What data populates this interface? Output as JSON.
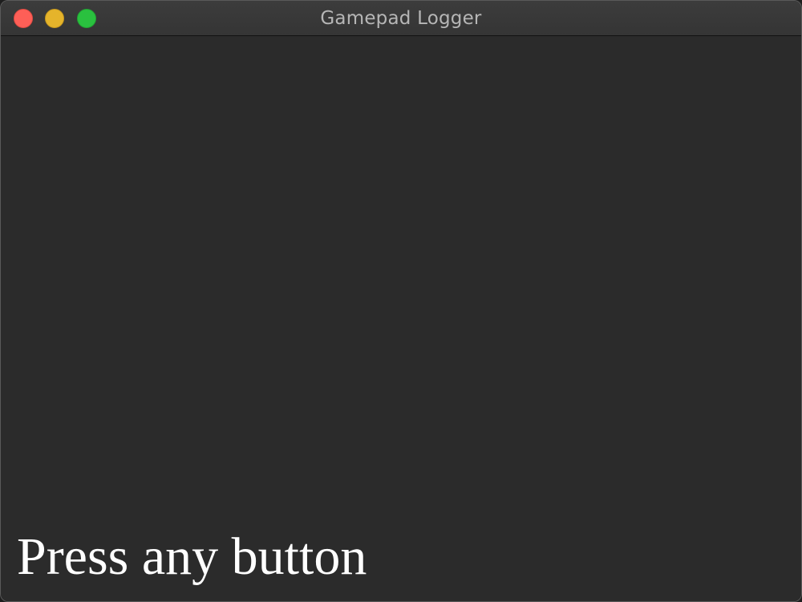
{
  "window": {
    "title": "Gamepad Logger"
  },
  "content": {
    "prompt": "Press any button"
  },
  "colors": {
    "background": "#2b2b2b",
    "titlebar": "#3a3a3a",
    "close": "#fe5f57",
    "minimize": "#e5b42b",
    "zoom": "#2ac13f",
    "text": "#ffffff"
  }
}
